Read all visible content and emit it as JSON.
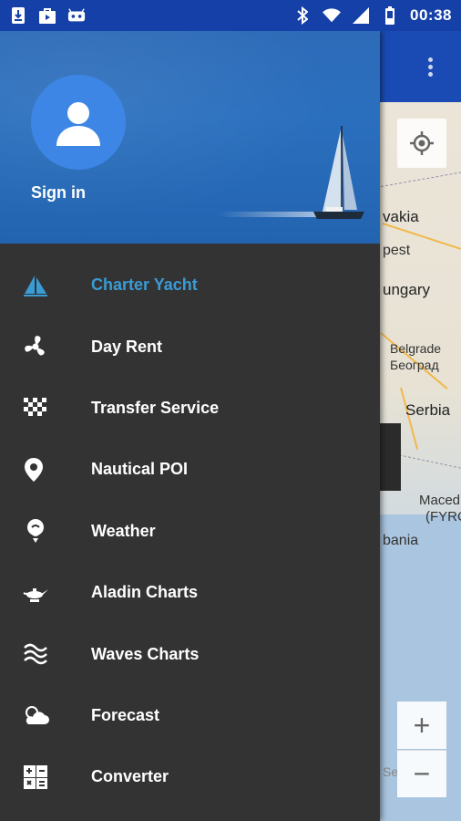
{
  "status_bar": {
    "time": "00:38",
    "left_icons": [
      "download-icon",
      "shopping-bag-icon",
      "android-icon"
    ],
    "right_icons": [
      "bluetooth-icon",
      "wifi-icon",
      "cell-signal-icon",
      "battery-icon"
    ]
  },
  "drawer": {
    "sign_in_label": "Sign in",
    "items": [
      {
        "label": "Charter Yacht",
        "icon": "sailboat-icon",
        "active": true
      },
      {
        "label": "Day Rent",
        "icon": "propeller-icon",
        "active": false
      },
      {
        "label": "Transfer Service",
        "icon": "checkered-flag-icon",
        "active": false
      },
      {
        "label": "Nautical POI",
        "icon": "location-pin-icon",
        "active": false
      },
      {
        "label": "Weather",
        "icon": "weather-icon",
        "active": false
      },
      {
        "label": "Aladin Charts",
        "icon": "lamp-icon",
        "active": false
      },
      {
        "label": "Waves Charts",
        "icon": "waves-icon",
        "active": false
      },
      {
        "label": "Forecast",
        "icon": "cloud-icon",
        "active": false
      },
      {
        "label": "Converter",
        "icon": "calculator-icon",
        "active": false
      }
    ]
  },
  "map": {
    "labels": [
      "vakia",
      "pest",
      "ungary",
      "Belgrade",
      "Београд",
      "Serbia",
      "Maced",
      "(FYRO",
      "bania",
      "Se"
    ],
    "zoom_in_label": "+",
    "zoom_out_label": "−"
  },
  "colors": {
    "status_bar": "#1440a8",
    "drawer_bg": "#333333",
    "active_item": "#3a9bd5",
    "avatar": "#3d86e6"
  }
}
